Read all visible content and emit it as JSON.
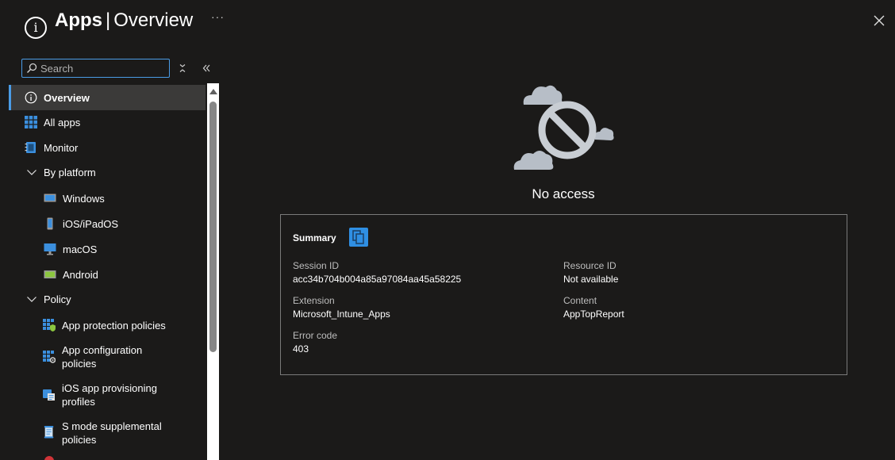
{
  "header": {
    "title_strong": "Apps",
    "separator": "|",
    "title_rest": "Overview",
    "more_label": "···"
  },
  "search": {
    "placeholder": "Search"
  },
  "sidebar": {
    "items": [
      {
        "label": "Overview",
        "icon": "info-icon"
      },
      {
        "label": "All apps",
        "icon": "grid-icon"
      },
      {
        "label": "Monitor",
        "icon": "monitor-book-icon"
      },
      {
        "label": "By platform",
        "icon": "chevron-down-icon"
      },
      {
        "label": "Windows",
        "icon": "windows-device-icon"
      },
      {
        "label": "iOS/iPadOS",
        "icon": "phone-icon"
      },
      {
        "label": "macOS",
        "icon": "desktop-icon"
      },
      {
        "label": "Android",
        "icon": "android-device-icon"
      },
      {
        "label": "Policy",
        "icon": "chevron-down-icon"
      },
      {
        "label": "App protection policies",
        "icon": "app-protection-icon"
      },
      {
        "label": "App configuration policies",
        "icon": "app-configuration-icon"
      },
      {
        "label": "iOS app provisioning profiles",
        "icon": "provisioning-profile-icon"
      },
      {
        "label": "S mode supplemental policies",
        "icon": "scroll-document-icon"
      }
    ]
  },
  "main": {
    "no_access": "No access",
    "summary": {
      "title": "Summary",
      "session_id_label": "Session ID",
      "session_id": "acc34b704b004a85a97084aa45a58225",
      "extension_label": "Extension",
      "extension": "Microsoft_Intune_Apps",
      "error_code_label": "Error code",
      "error_code": "403",
      "resource_id_label": "Resource ID",
      "resource_id": "Not available",
      "content_label": "Content",
      "content": "AppTopReport"
    }
  },
  "colors": {
    "background": "#1b1a19",
    "accent": "#4a9ce6",
    "active_item": "#3b3a39"
  }
}
